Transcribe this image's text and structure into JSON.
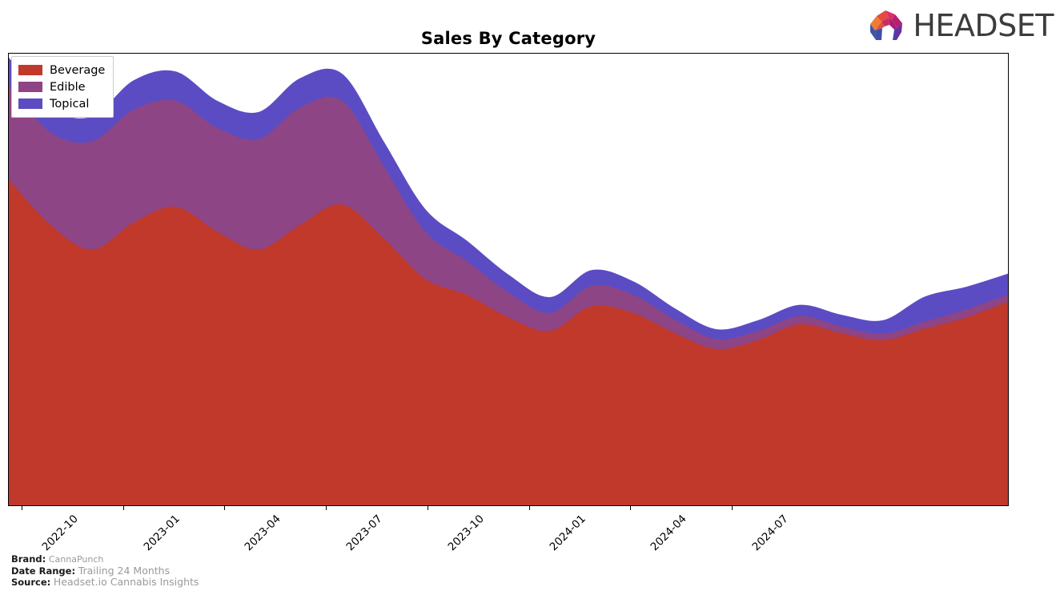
{
  "header": {
    "title": "Sales By Category",
    "logo_text": "HEADSET",
    "logo_mark_name": "headset-arch-logo"
  },
  "legend": {
    "position": "upper-left",
    "items": [
      {
        "label": "Beverage",
        "color": "#c0392b"
      },
      {
        "label": "Edible",
        "color": "#8e4585"
      },
      {
        "label": "Topical",
        "color": "#5b4cc4"
      }
    ]
  },
  "footer": {
    "brand_label": "Brand:",
    "brand_value": "CannaPunch",
    "date_range_label": "Date Range:",
    "date_range_value": "Trailing 24 Months",
    "source_label": "Source:",
    "source_value": "Headset.io Cannabis Insights"
  },
  "chart_data": {
    "type": "area",
    "stacked": true,
    "title": "Sales By Category",
    "xlabel": "",
    "ylabel": "",
    "grid": false,
    "legend_position": "upper-left",
    "x": [
      "2022-09",
      "2022-10",
      "2022-11",
      "2022-12",
      "2023-01",
      "2023-02",
      "2023-03",
      "2023-04",
      "2023-05",
      "2023-06",
      "2023-07",
      "2023-08",
      "2023-09",
      "2023-10",
      "2023-11",
      "2023-12",
      "2024-01",
      "2024-02",
      "2024-03",
      "2024-04",
      "2024-05",
      "2024-06",
      "2024-07",
      "2024-08",
      "2024-09"
    ],
    "tick_labels": [
      "2022-10",
      "2023-01",
      "2023-04",
      "2023-07",
      "2023-10",
      "2024-01",
      "2024-04",
      "2024-07"
    ],
    "tick_x": [
      17,
      144,
      270,
      397,
      524,
      651,
      777,
      904
    ],
    "ylim": [
      0,
      100
    ],
    "series": [
      {
        "name": "Beverage",
        "color": "#c0392b",
        "values": [
          72.0,
          62.0,
          56.5,
          62.5,
          66.0,
          60.5,
          56.5,
          62.0,
          66.5,
          59.0,
          50.0,
          46.5,
          41.5,
          38.5,
          44.0,
          42.5,
          38.0,
          34.5,
          36.5,
          40.0,
          38.0,
          36.5,
          39.0,
          41.5,
          45.0
        ]
      },
      {
        "name": "Edible",
        "color": "#8e4585",
        "values": [
          21.0,
          20.5,
          24.0,
          25.0,
          23.5,
          23.0,
          24.5,
          26.0,
          23.0,
          16.0,
          10.5,
          7.5,
          5.5,
          4.0,
          4.5,
          4.0,
          3.0,
          2.2,
          2.0,
          1.8,
          1.5,
          1.4,
          1.6,
          1.8,
          1.6
        ]
      },
      {
        "name": "Topical",
        "color": "#5b4cc4",
        "values": [
          6.0,
          5.5,
          5.5,
          6.5,
          6.5,
          6.0,
          6.0,
          6.5,
          6.0,
          5.5,
          5.0,
          4.5,
          4.0,
          3.5,
          3.5,
          3.0,
          2.5,
          2.2,
          2.4,
          2.5,
          2.6,
          3.0,
          5.5,
          5.0,
          4.6
        ]
      }
    ]
  }
}
